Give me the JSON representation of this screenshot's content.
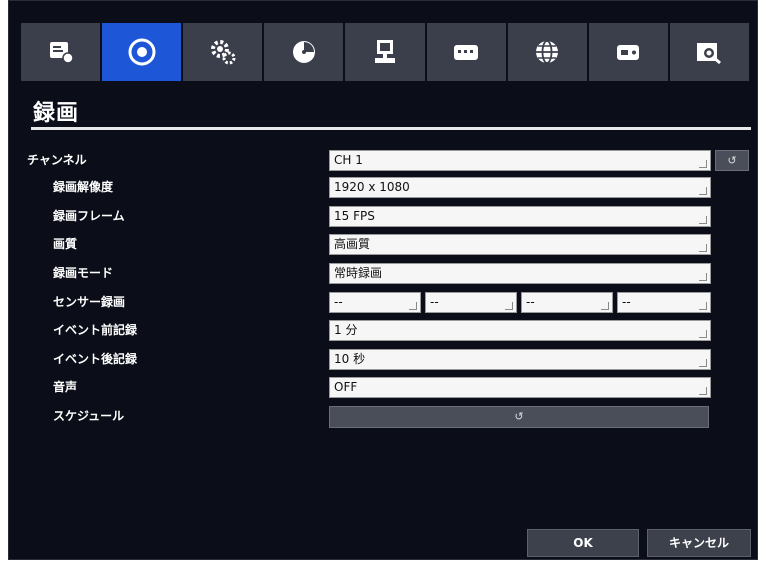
{
  "tabs": [
    {
      "icon": "display-settings-icon",
      "active": false
    },
    {
      "icon": "record-icon",
      "active": true
    },
    {
      "icon": "gear-icon",
      "active": false
    },
    {
      "icon": "clock-icon",
      "active": false
    },
    {
      "icon": "computer-icon",
      "active": false
    },
    {
      "icon": "keyboard-icon",
      "active": false
    },
    {
      "icon": "globe-icon",
      "active": false
    },
    {
      "icon": "storage-icon",
      "active": false
    },
    {
      "icon": "camera-search-icon",
      "active": false
    }
  ],
  "page_title": "録画",
  "form": {
    "channel": {
      "label": "チャンネル",
      "value": "CH 1"
    },
    "resolution": {
      "label": "録画解像度",
      "value": "1920 x 1080"
    },
    "frame": {
      "label": "録画フレーム",
      "value": "15 FPS"
    },
    "quality": {
      "label": "画質",
      "value": "高画質"
    },
    "mode": {
      "label": "録画モード",
      "value": "常時録画"
    },
    "sensor": {
      "label": "センサー録画",
      "values": [
        "--",
        "--",
        "--",
        "--"
      ]
    },
    "pre_event": {
      "label": "イベント前記録",
      "value": "1 分"
    },
    "post_event": {
      "label": "イベント後記録",
      "value": "10 秒"
    },
    "audio": {
      "label": "音声",
      "value": "OFF"
    },
    "schedule": {
      "label": "スケジュール"
    }
  },
  "buttons": {
    "ok": "OK",
    "cancel": "キャンセル"
  },
  "colors": {
    "background": "#0b0d18",
    "tab": "#3b3f4c",
    "active_tab": "#1d56d6",
    "field": "#f6f6f6"
  }
}
